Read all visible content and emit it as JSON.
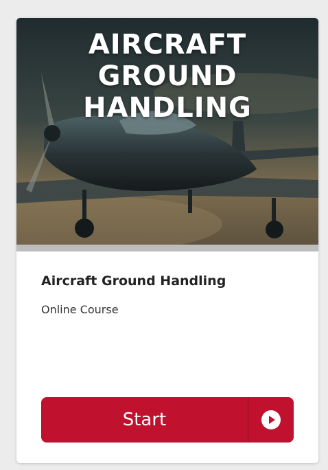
{
  "card": {
    "hero_title_line1": "AIRCRAFT GROUND",
    "hero_title_line2": "HANDLING",
    "course_title": "Aircraft Ground Handling",
    "course_type": "Online Course",
    "start_label": "Start",
    "start_icon": "play-circle-icon"
  },
  "colors": {
    "button": "#c0112f",
    "text": "#222222"
  }
}
